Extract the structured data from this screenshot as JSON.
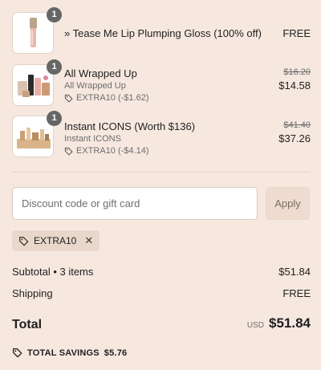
{
  "items": [
    {
      "quantity": "1",
      "title": "» Tease Me Lip Plumping Gloss (100% off)",
      "price": "FREE",
      "image": "lip-gloss-tube-image"
    },
    {
      "quantity": "1",
      "title": "All Wrapped Up",
      "subtitle": "All Wrapped Up",
      "discount": "EXTRA10 (-$1.62)",
      "original_price": "$16.20",
      "price": "$14.58",
      "image": "gift-set-image"
    },
    {
      "quantity": "1",
      "title": "Instant ICONS (Worth $136)",
      "subtitle": "Instant ICONS",
      "discount": "EXTRA10 (-$4.14)",
      "original_price": "$41.40",
      "price": "$37.26",
      "image": "makeup-collection-image"
    }
  ],
  "discount": {
    "placeholder": "Discount code or gift card",
    "apply_label": "Apply",
    "applied_code": "EXTRA10",
    "remove_icon": "close-icon"
  },
  "summary": {
    "subtotal_label": "Subtotal • 3 items",
    "subtotal_value": "$51.84",
    "shipping_label": "Shipping",
    "shipping_value": "FREE",
    "total_label": "Total",
    "currency": "USD",
    "total_value": "$51.84",
    "savings_label": "TOTAL SAVINGS",
    "savings_value": "$5.76"
  },
  "colors": {
    "background": "#f6e8df",
    "badge": "#666666",
    "chip": "#ead7cb",
    "apply_button": "#efdcd1"
  }
}
